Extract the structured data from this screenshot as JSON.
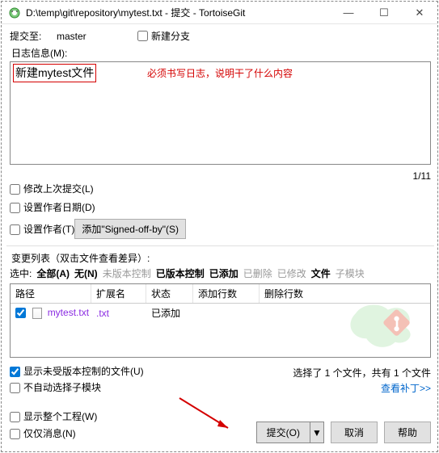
{
  "window": {
    "title": "D:\\temp\\git\\repository\\mytest.txt - 提交 - TortoiseGit",
    "min": "—",
    "max": "☐",
    "close": "✕"
  },
  "top": {
    "commit_to_label": "提交至:",
    "branch": "master",
    "new_branch": "新建分支"
  },
  "log": {
    "label": "日志信息(M):",
    "entered": "新建mytest文件",
    "annotation": "必须书写日志，说明干了什么内容",
    "counter": "1/11"
  },
  "opts": {
    "amend": "修改上次提交(L)",
    "author_date": "设置作者日期(D)",
    "set_author": "设置作者(T)",
    "signed_btn": "添加\"Signed-off-by\"(S)"
  },
  "changes": {
    "header": "变更列表（双击文件查看差异）:",
    "selected_label": "选中:",
    "filters": {
      "all": "全部(A)",
      "none": "无(N)",
      "unversioned": "未版本控制",
      "versioned": "已版本控制",
      "added": "已添加",
      "deleted": "已删除",
      "modified": "已修改",
      "files": "文件",
      "submodules": "子模块"
    },
    "cols": {
      "path": "路径",
      "ext": "扩展名",
      "status": "状态",
      "add_lines": "添加行数",
      "del_lines": "删除行数"
    },
    "rows": [
      {
        "checked": true,
        "name": "mytest.txt",
        "ext": ".txt",
        "status": "已添加",
        "add": "",
        "del": ""
      }
    ],
    "summary": "选择了 1 个文件，共有 1 个文件",
    "patch_link": "查看补丁>>",
    "show_unversioned": "显示未受版本控制的文件(U)",
    "no_autoselect_sub": "不自动选择子模块"
  },
  "bottom": {
    "whole_project": "显示整个工程(W)",
    "msg_only": "仅仅消息(N)",
    "commit": "提交(O)",
    "dropdown": "▼",
    "cancel": "取消",
    "help": "帮助"
  }
}
